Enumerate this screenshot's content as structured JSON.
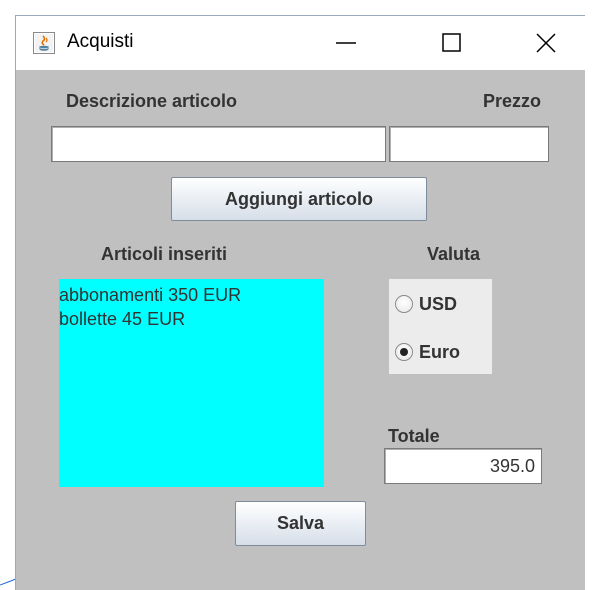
{
  "window": {
    "title": "Acquisti",
    "buttons": {
      "minimize": "minimize-icon",
      "maximize": "maximize-icon",
      "close": "close-icon"
    }
  },
  "form": {
    "description_label": "Descrizione articolo",
    "price_label": "Prezzo",
    "description_value": "",
    "price_value": "",
    "add_button": "Aggiungi articolo"
  },
  "items": {
    "label": "Articoli inseriti",
    "list": [
      "abbonamenti 350 EUR",
      "bollette 45 EUR"
    ],
    "background": "#00ffff"
  },
  "currency": {
    "label": "Valuta",
    "options": [
      {
        "label": "USD",
        "selected": false
      },
      {
        "label": "Euro",
        "selected": true
      }
    ]
  },
  "total": {
    "label": "Totale",
    "value": "395.0"
  },
  "save_button": "Salva"
}
